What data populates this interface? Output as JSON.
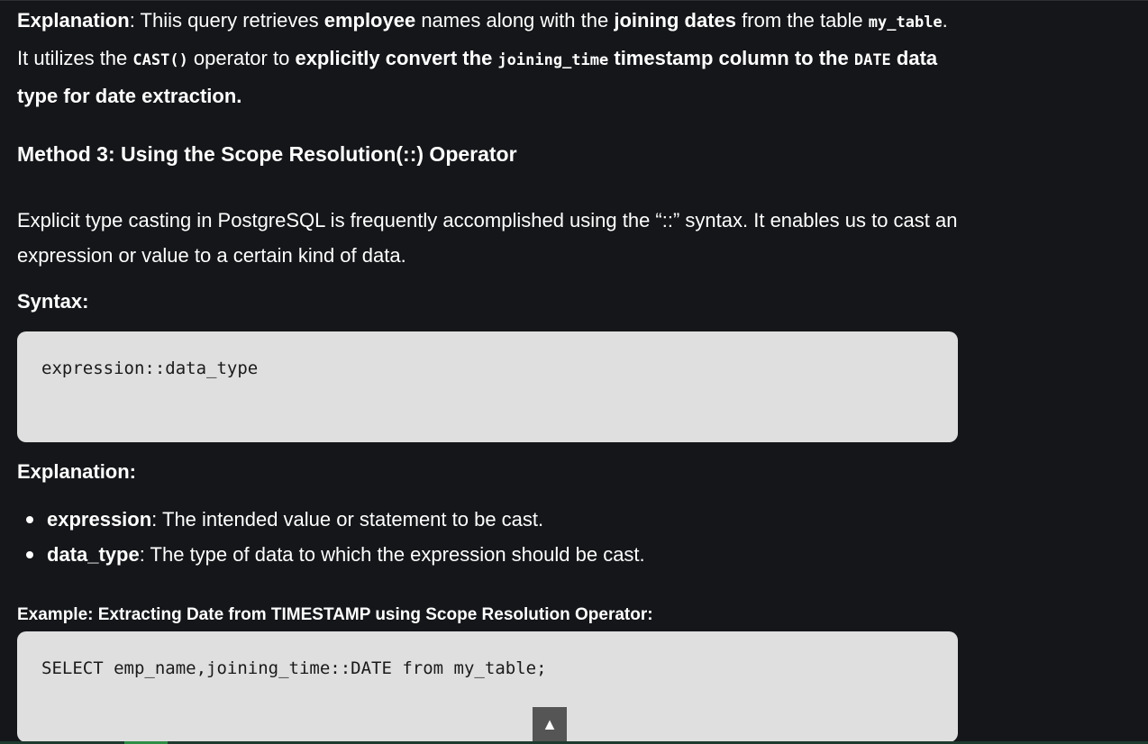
{
  "intro": {
    "t1": "Explanation",
    "t2": ": Thiis query retrieves ",
    "t3": "employee",
    "t4": " names along with the ",
    "t5": "joining dates",
    "t6": " from the table ",
    "c1": "my_table",
    "t7": ". It utilizes the ",
    "c2": "CAST()",
    "t8": " operator to ",
    "t9": "explicitly convert the ",
    "c3": "joining_time",
    "t10": " timestamp column to the ",
    "c4": "DATE",
    "t11": " data type for date extraction."
  },
  "method_heading": "Method 3: Using the Scope Resolution(::) Operator",
  "description": "Explicit type casting in PostgreSQL is frequently accomplished using the “::” syntax. It enables us to cast an expression or value to a certain kind of data.",
  "syntax_heading": "Syntax:",
  "syntax_code": "expression::data_type",
  "explanation_heading": "Explanation:",
  "bullets": [
    {
      "term": "expression",
      "text": ": The intended value or statement to be cast."
    },
    {
      "term": "data_type",
      "text": ": The type of data to which the expression should be cast."
    }
  ],
  "example_heading": "Example: Extracting Date from TIMESTAMP using Scope Resolution Operator:",
  "example_code": "SELECT emp_name,joining_time::DATE from my_table;",
  "scroll_top_glyph": "▲"
}
